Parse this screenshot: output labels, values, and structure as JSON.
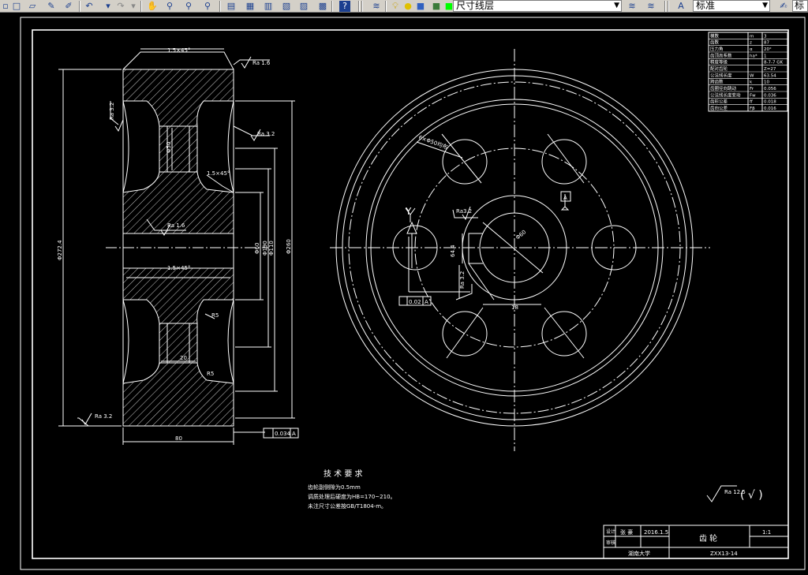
{
  "toolbar": {
    "layer_name": "尺寸线层",
    "text_style": "标准",
    "right_label": "标",
    "icons": [
      "new-icon",
      "open-icon",
      "pencil-icon",
      "eraser-icon",
      "undo-icon",
      "redo-icon",
      "pan-icon",
      "zoom-icon",
      "zoom-window-icon",
      "zoom-previous-icon",
      "properties-icon",
      "design-center-icon",
      "tool-palette-icon",
      "sheet-set-icon",
      "markup-icon",
      "calculator-icon",
      "help-icon",
      "layer-manager-icon",
      "layer-state-icon",
      "layer-previous-icon",
      "text-style-icon",
      "dim-style-icon"
    ]
  },
  "drawing": {
    "title_block": {
      "row1_label": "设计",
      "row1_name": "张 豪",
      "row1_date": "2016.1.5",
      "row2_label": "审核",
      "part_name": "齿 轮",
      "scale": "1:1",
      "school": "湖南大学",
      "drawing_no": "ZXX13-14"
    },
    "tech_requirements": {
      "heading": "技 术 要 求",
      "lines": [
        "齿轮副侧隙为0.5mm",
        "调质处理后硬度为HB=170~210。",
        "未注尺寸公差按GB/T1804-m。"
      ]
    },
    "roughness_note": {
      "symbol": "Ra 12.5",
      "paren": "( √ )"
    },
    "param_table": {
      "rows": [
        [
          "模数",
          "m",
          "3"
        ],
        [
          "齿数",
          "z",
          "87"
        ],
        [
          "压力角",
          "α",
          "20°"
        ],
        [
          "齿顶高系数",
          "ha*",
          "1"
        ],
        [
          "精度等级",
          "",
          "8-7-7 GK"
        ],
        [
          "配对齿轮",
          "",
          "Z=27"
        ],
        [
          "公法线长度",
          "W",
          "63.54"
        ],
        [
          "跨齿数",
          "k",
          "10"
        ],
        [
          "齿圈径向跳动",
          "Fr",
          "0.056"
        ],
        [
          "公法线长度变动",
          "Fw",
          "0.036"
        ],
        [
          "齿形公差",
          "ff",
          "0.018"
        ],
        [
          "齿向公差",
          "Fβ",
          "0.016"
        ]
      ]
    },
    "section_dims": {
      "chamfer_top": "1.5×45°",
      "chamfer_mid": "1.5×45°",
      "chamfer_side": "1.5×45°",
      "ra_top": "Ra 1.6",
      "ra_mid": "Ra 3.2",
      "ra_bore": "Ra 1.6",
      "ra_side": "Ra 3.2",
      "ra_bottom": "Ra 3.2",
      "dia_outer": "Φ272.4",
      "dia_260": "Φ260",
      "dia_hub": "Φ110",
      "dia_bore": "Φ60",
      "dia_web": "Φ190",
      "dia_holes": "Φ150",
      "width_20": "20",
      "width_total": "80",
      "bore_width": "Φ50",
      "radius": "R5",
      "radius2": "R5",
      "runout_tol": "0.034",
      "runout_datum": "A"
    },
    "front_dims": {
      "holes_label": "6×Φ50均布",
      "keyway_depth": "64.4",
      "keyway_width": "18",
      "keyway_tol": "0.02",
      "keyway_datum": "A",
      "ra_key": "Ra3.2",
      "ra_key2": "Ra 3.2",
      "bore_dia": "Φ60",
      "datum_a": "A",
      "view_label": "Y"
    }
  }
}
